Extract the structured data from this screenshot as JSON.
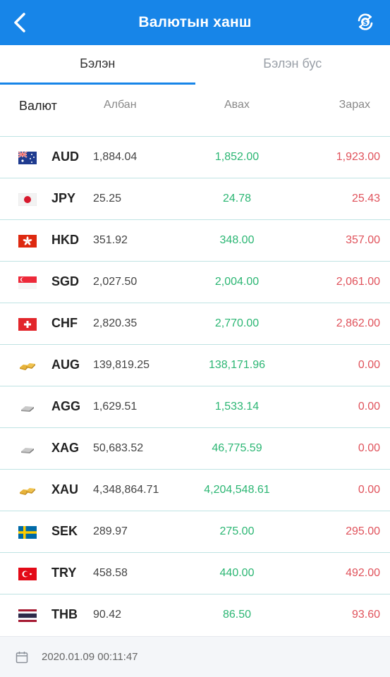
{
  "header": {
    "title": "Валютын ханш",
    "back_icon": "chevron-left-icon",
    "action_icon": "currency-exchange-icon"
  },
  "tabs": [
    {
      "label": "Бэлэн",
      "active": true
    },
    {
      "label": "Бэлэн бус",
      "active": false
    }
  ],
  "table": {
    "columns": {
      "currency": "Валют",
      "official": "Албан",
      "buy": "Авах",
      "sell": "Зарах"
    },
    "rows": [
      {
        "code": "AUD",
        "flag": "au-flag-icon",
        "official": "1,884.04",
        "buy": "1,852.00",
        "sell": "1,923.00"
      },
      {
        "code": "JPY",
        "flag": "jp-flag-icon",
        "official": "25.25",
        "buy": "24.78",
        "sell": "25.43"
      },
      {
        "code": "HKD",
        "flag": "hk-flag-icon",
        "official": "351.92",
        "buy": "348.00",
        "sell": "357.00"
      },
      {
        "code": "SGD",
        "flag": "sg-flag-icon",
        "official": "2,027.50",
        "buy": "2,004.00",
        "sell": "2,061.00"
      },
      {
        "code": "CHF",
        "flag": "ch-flag-icon",
        "official": "2,820.35",
        "buy": "2,770.00",
        "sell": "2,862.00"
      },
      {
        "code": "AUG",
        "flag": "gold-bars-icon",
        "official": "139,819.25",
        "buy": "138,171.96",
        "sell": "0.00"
      },
      {
        "code": "AGG",
        "flag": "silver-bar-icon",
        "official": "1,629.51",
        "buy": "1,533.14",
        "sell": "0.00"
      },
      {
        "code": "XAG",
        "flag": "silver-bar-icon",
        "official": "50,683.52",
        "buy": "46,775.59",
        "sell": "0.00"
      },
      {
        "code": "XAU",
        "flag": "gold-bars-icon",
        "official": "4,348,864.71",
        "buy": "4,204,548.61",
        "sell": "0.00"
      },
      {
        "code": "SEK",
        "flag": "se-flag-icon",
        "official": "289.97",
        "buy": "275.00",
        "sell": "295.00"
      },
      {
        "code": "TRY",
        "flag": "tr-flag-icon",
        "official": "458.58",
        "buy": "440.00",
        "sell": "492.00"
      },
      {
        "code": "THB",
        "flag": "th-flag-icon",
        "official": "90.42",
        "buy": "86.50",
        "sell": "93.60"
      }
    ]
  },
  "footer": {
    "timestamp": "2020.01.09 00:11:47",
    "icon": "calendar-icon"
  },
  "colors": {
    "primary": "#1785e8",
    "buy": "#2bb673",
    "sell": "#e0525b",
    "divider": "#bfe3e3"
  }
}
